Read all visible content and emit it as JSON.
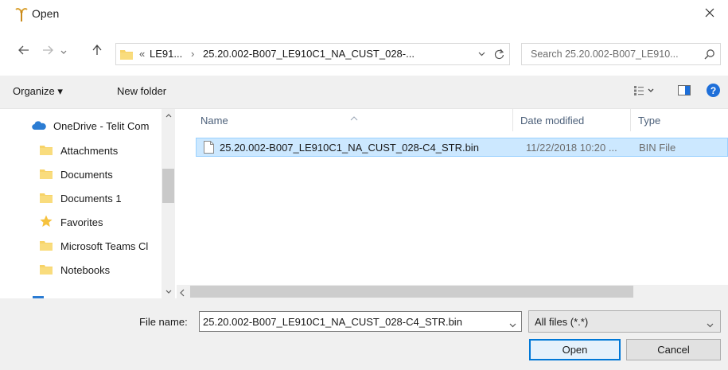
{
  "window": {
    "title": "Open"
  },
  "address": {
    "overflow_glyph": "«",
    "seg1": "LE91...",
    "sep": "›",
    "seg2": "25.20.002-B007_LE910C1_NA_CUST_028-..."
  },
  "search": {
    "placeholder": "Search 25.20.002-B007_LE910..."
  },
  "toolbar": {
    "organize": "Organize ▾",
    "new_folder": "New folder"
  },
  "navpane": {
    "root": "OneDrive - Telit Com",
    "items": [
      "Attachments",
      "Documents",
      "Documents 1",
      "Favorites",
      "Microsoft Teams Cl",
      "Notebooks"
    ]
  },
  "columns": {
    "name": "Name",
    "date": "Date modified",
    "type": "Type"
  },
  "files": [
    {
      "name": "25.20.002-B007_LE910C1_NA_CUST_028-C4_STR.bin",
      "date": "11/22/2018 10:20 ...",
      "type": "BIN File"
    }
  ],
  "bottom": {
    "filename_label": "File name:",
    "filename_value": "25.20.002-B007_LE910C1_NA_CUST_028-C4_STR.bin",
    "filetype": "All files (*.*)",
    "open_button": "Open",
    "cancel_button": "Cancel"
  },
  "colors": {
    "selection": "#cce8ff",
    "accent": "#0078d7",
    "folder": "#f7d368",
    "help": "#1e6fd9"
  }
}
